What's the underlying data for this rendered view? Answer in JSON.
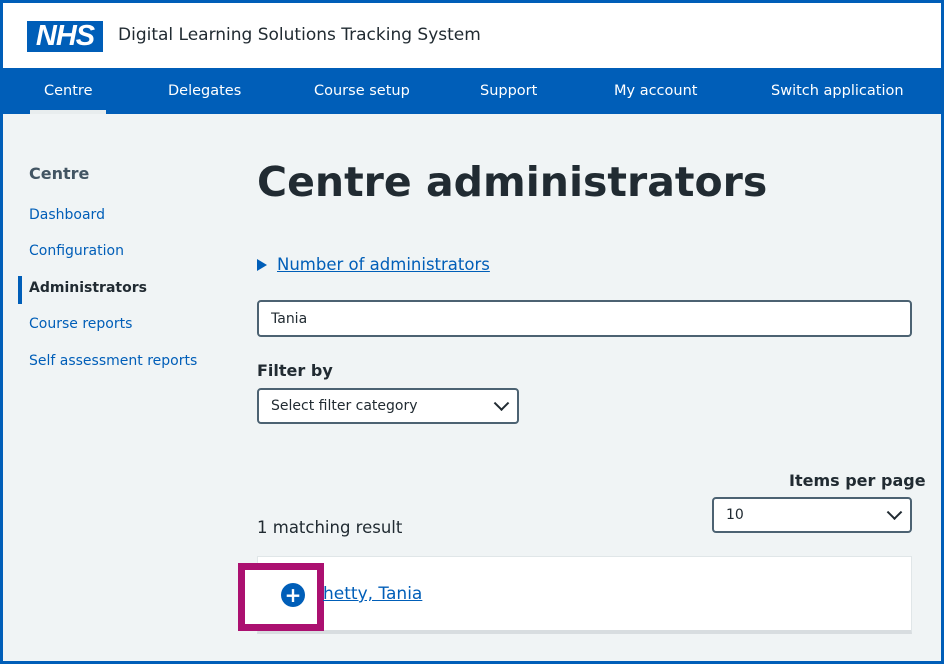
{
  "header": {
    "logo_text": "NHS",
    "app_title": "Digital Learning Solutions Tracking System"
  },
  "nav": {
    "items": [
      {
        "label": "Centre",
        "active": true
      },
      {
        "label": "Delegates"
      },
      {
        "label": "Course setup"
      },
      {
        "label": "Support"
      },
      {
        "label": "My account"
      },
      {
        "label": "Switch application"
      }
    ]
  },
  "sidebar": {
    "heading": "Centre",
    "items": [
      {
        "label": "Dashboard"
      },
      {
        "label": "Configuration"
      },
      {
        "label": "Administrators",
        "current": true
      },
      {
        "label": "Course reports"
      },
      {
        "label": "Self assessment reports"
      }
    ]
  },
  "main": {
    "title": "Centre administrators",
    "details_summary": "Number of administrators",
    "search_value": "Tania",
    "filter_label": "Filter by",
    "filter_select": "Select filter category",
    "items_per_page_label": "Items per page",
    "items_per_page_value": "10",
    "result_count": "1 matching result",
    "results": [
      {
        "name": "Chetty, Tania",
        "visible_name": "hetty, Tania"
      }
    ]
  },
  "colors": {
    "nhs_blue": "#005eb8",
    "background": "#f0f4f5",
    "text": "#212b32",
    "highlight": "#ab1070"
  },
  "icons": {
    "expand": "plus-circle-icon",
    "dropdown": "chevron-down-icon",
    "details": "triangle-right-icon"
  }
}
